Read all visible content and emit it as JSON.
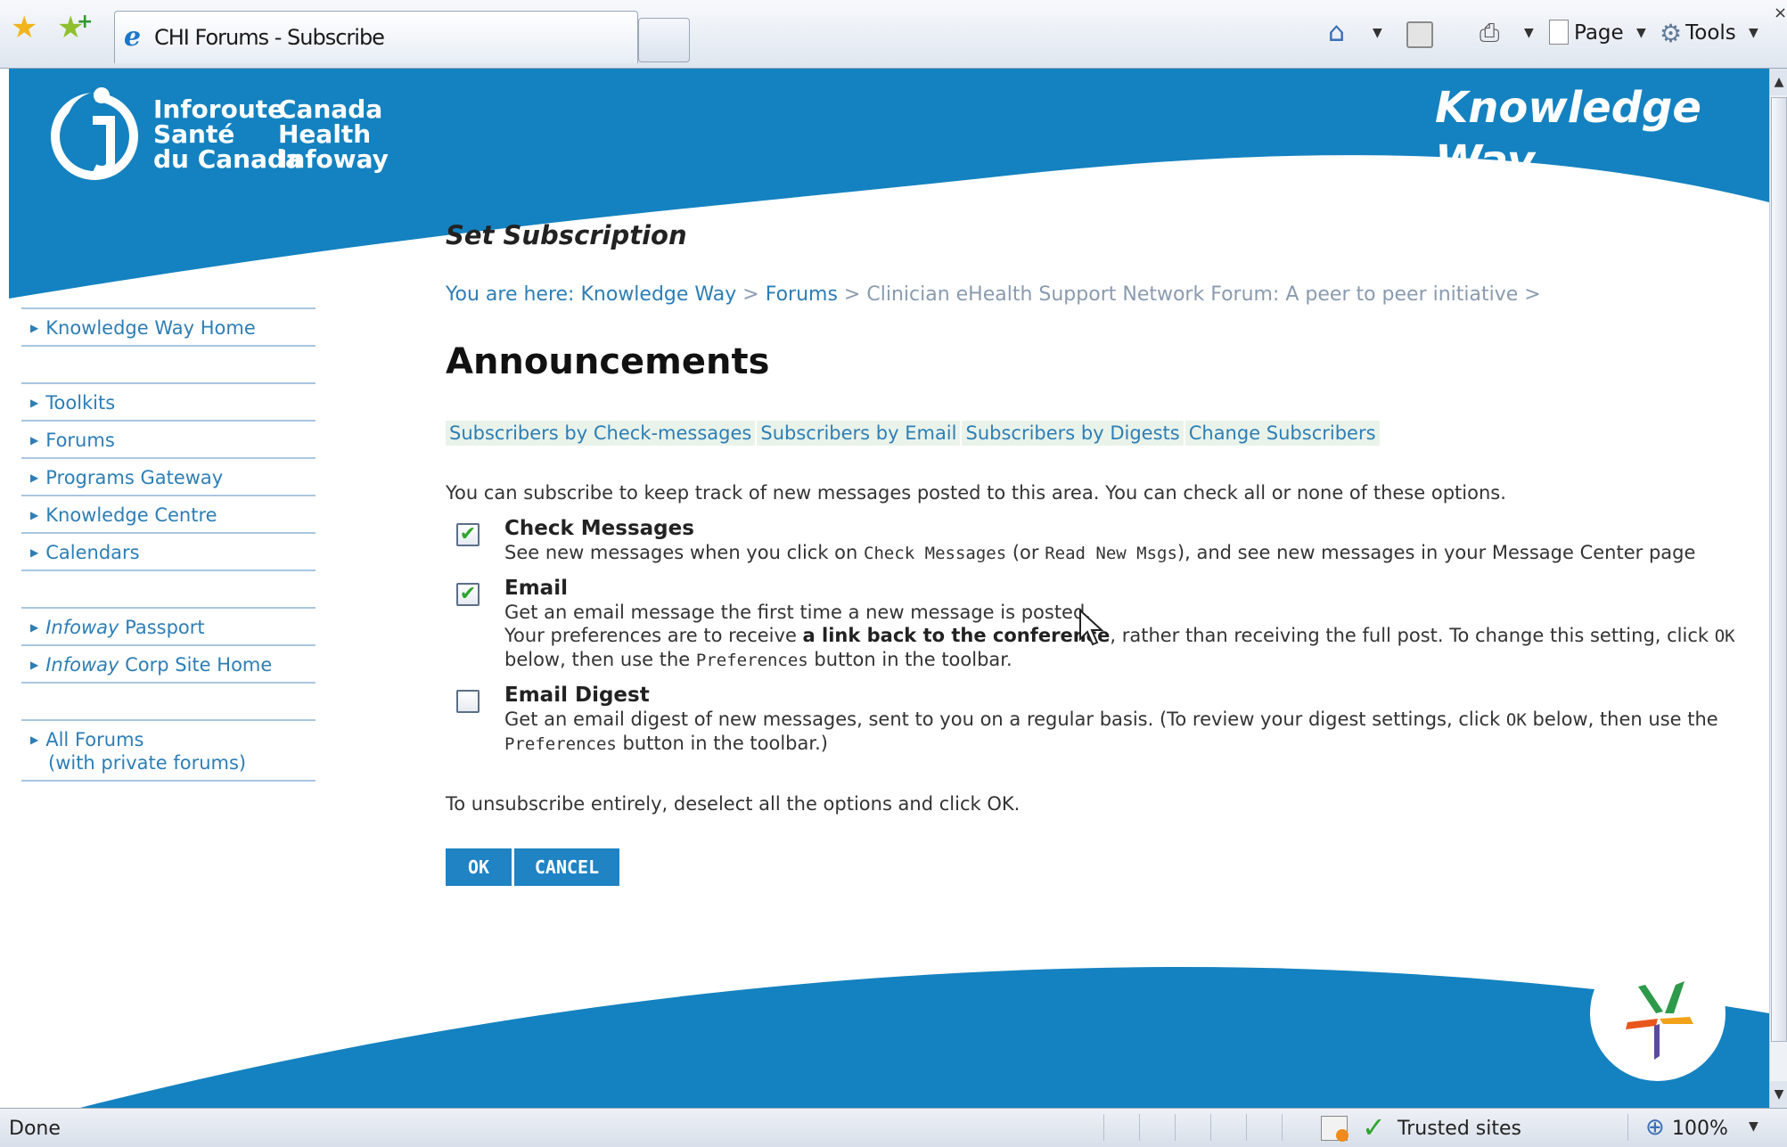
{
  "browser": {
    "tab_title": "CHI Forums - Subscribe",
    "toolbar": {
      "page_label": "Page",
      "tools_label": "Tools"
    },
    "status_text": "Done",
    "zone_label": "Trusted sites",
    "zoom_label": "100%"
  },
  "header": {
    "logo_fr": [
      "Inforoute",
      "Santé",
      "du Canada"
    ],
    "logo_en": [
      "Canada",
      "Health",
      "Infoway"
    ],
    "site_title": "Knowledge Way"
  },
  "sidebar": {
    "groups": [
      {
        "items": [
          {
            "label": "Knowledge Way Home"
          }
        ]
      },
      {
        "items": [
          {
            "label": "Toolkits"
          },
          {
            "label": "Forums"
          },
          {
            "label": "Programs Gateway"
          },
          {
            "label": "Knowledge Centre"
          },
          {
            "label": "Calendars"
          }
        ]
      },
      {
        "items": [
          {
            "italic": "Infoway",
            "label": " Passport"
          },
          {
            "italic": "Infoway",
            "label": " Corp Site Home"
          }
        ]
      },
      {
        "items": [
          {
            "label": "All Forums",
            "sub": "(with private forums)"
          }
        ]
      }
    ]
  },
  "main": {
    "section_title": "Set Subscription",
    "breadcrumb": {
      "prefix": "You are here:",
      "links": [
        "Knowledge Way",
        "Forums"
      ],
      "sep": ">",
      "current": "Clinician eHealth Support Network Forum: A peer to peer initiative >"
    },
    "page_title": "Announcements",
    "sub_links": [
      "Subscribers by Check-messages",
      "Subscribers by Email",
      "Subscribers by Digests",
      "Change Subscribers"
    ],
    "intro": "You can subscribe to keep track of new messages posted to this area. You can check all or none of these options.",
    "options": {
      "check_messages": {
        "checked": true,
        "label": "Check Messages",
        "desc_1": "See new messages when you click on ",
        "code_1": "Check Messages",
        "desc_2": " (or ",
        "code_2": "Read New Msgs",
        "desc_3": "), and see new messages in your Message Center page"
      },
      "email": {
        "checked": true,
        "label": "Email",
        "line_1": "Get an email message the first time a new message is posted.",
        "line_2a": "Your preferences are to receive ",
        "line_2b": "a link back to the conference",
        "line_2c": ", rather than receiving the full post. To change this setting, click ",
        "code_ok": "OK",
        "line_2d": " below, then use the ",
        "code_pref": "Preferences",
        "line_2e": " button in the toolbar."
      },
      "email_digest": {
        "checked": false,
        "label": "Email Digest",
        "desc_a": "Get an email digest of new messages, sent to you on a regular basis. (To review your digest settings, click ",
        "code_ok": "OK",
        "desc_b": " below, then use the ",
        "code_pref": "Preferences",
        "desc_c": " button in the toolbar.)"
      }
    },
    "unsubscribe_note": "To unsubscribe entirely, deselect all the options and click OK.",
    "buttons": {
      "ok": "OK",
      "cancel": "CANCEL"
    }
  },
  "colors": {
    "brand_blue": "#1482c0",
    "link_blue": "#2d7eb5",
    "button_blue": "#1f83c4"
  }
}
